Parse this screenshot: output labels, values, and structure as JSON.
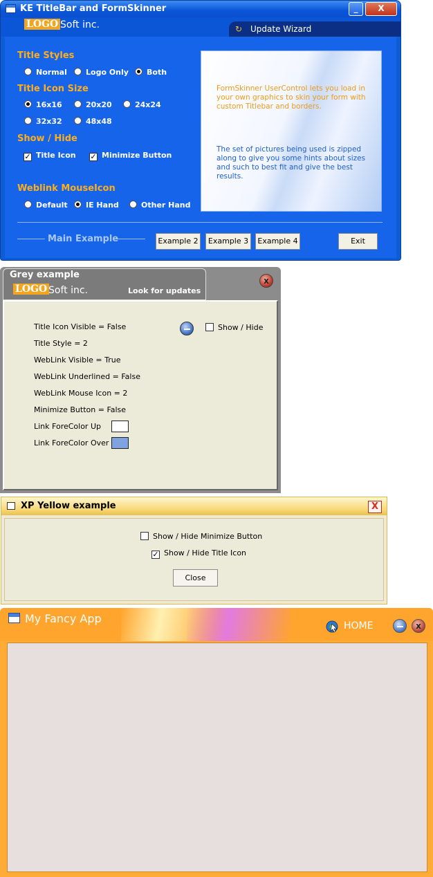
{
  "blue_window": {
    "title": "KE TitleBar and FormSkinner",
    "logo": "LOGO",
    "company": "Soft inc.",
    "update_wizard": "Update Wizard",
    "minimize_glyph": "_",
    "close_glyph": "X",
    "sections": {
      "title_styles": "Title Styles",
      "title_icon_size": "Title Icon Size",
      "show_hide": "Show / Hide",
      "weblink": "Weblink  MouseIcon"
    },
    "title_styles": [
      "Normal",
      "Logo Only",
      "Both"
    ],
    "icon_sizes": [
      "16x16",
      "20x20",
      "24x24",
      "32x32",
      "48x48"
    ],
    "show_hide": [
      "Title Icon",
      "Minimize Button"
    ],
    "weblink_icons": [
      "Default",
      "IE Hand",
      "Other Hand"
    ],
    "info_1": "FormSkinner UserControl lets you load in your own graphics to skin your form with custom Titlebar and borders.",
    "info_2": "The set of pictures being used is zipped along to give you some hints about sizes and such to best fit and give the best results.",
    "main_example": "Main Example",
    "buttons": {
      "example2": "Example 2",
      "example3": "Example 3",
      "example4": "Example 4",
      "exit": "Exit"
    }
  },
  "grey_window": {
    "title": "Grey example",
    "logo": "LOGO",
    "company": "Soft inc.",
    "look_for_updates": "Look for updates",
    "close_glyph": "x",
    "show_hide": "Show / Hide",
    "lines": [
      "Title Icon Visible = False",
      "Title Style = 2",
      "WebLink Visible = True",
      "WebLink Underlined = False",
      "WebLink Mouse Icon = 2",
      "Minimize Button = False",
      "Link ForeColor Up",
      "Link ForeColor Over"
    ],
    "swatch_colors": [
      "#ffffff",
      "#7fa2e0"
    ]
  },
  "yellow_window": {
    "title": "XP Yellow example",
    "close_glyph": "X",
    "opt_minimize": "Show / Hide Minimize Button",
    "opt_title_icon": "Show / Hide Title Icon",
    "close_button": "Close"
  },
  "orange_window": {
    "title": "My Fancy App",
    "home": "HOME",
    "close_glyph": "x"
  }
}
